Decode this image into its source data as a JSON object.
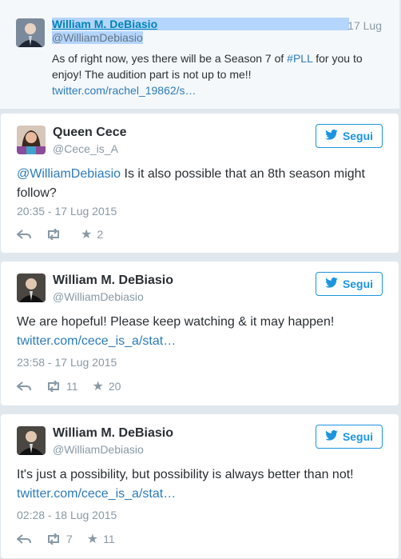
{
  "parent_tweet": {
    "fullname": "William M. DeBiasio",
    "screen_name": "@WilliamDebiasio",
    "time": "17 Lug",
    "text_line1_before": "As of right now, yes there will be a Season 7 of ",
    "hashtag": "#PLL",
    "text_line1_after": " for you to",
    "text_line2": "enjoy! The audition part is not up to me!!",
    "link": "twitter.com/rachel_19862/s…"
  },
  "tweets": [
    {
      "fullname": "Queen Cece",
      "screen_name": "@Cece_is_A",
      "follow_label": "Segui",
      "mention": "@WilliamDebiasio",
      "text": " Is it also possible that an 8th season might follow?",
      "date": "20:35 - 17 Lug 2015",
      "retweets": "",
      "likes": "2"
    },
    {
      "fullname": "William M. DeBiasio",
      "screen_name": "@WilliamDebiasio",
      "follow_label": "Segui",
      "text": "We are hopeful!  Please keep watching & it may happen!",
      "link": "twitter.com/cece_is_a/stat…",
      "date": "23:58 - 17 Lug 2015",
      "retweets": "11",
      "likes": "20"
    },
    {
      "fullname": "William M. DeBiasio",
      "screen_name": "@WilliamDebiasio",
      "follow_label": "Segui",
      "text": "It's just a possibility, but possibility is always better than not!",
      "link": "twitter.com/cece_is_a/stat…",
      "date": "02:28 - 18 Lug 2015",
      "retweets": "7",
      "likes": "11"
    }
  ],
  "colors": {
    "link": "#2b7bb9",
    "follow": "#1b95e0",
    "muted": "#8899a6"
  },
  "icons": [
    "reply-icon",
    "retweet-icon",
    "favorite-icon",
    "twitter-bird-icon"
  ]
}
